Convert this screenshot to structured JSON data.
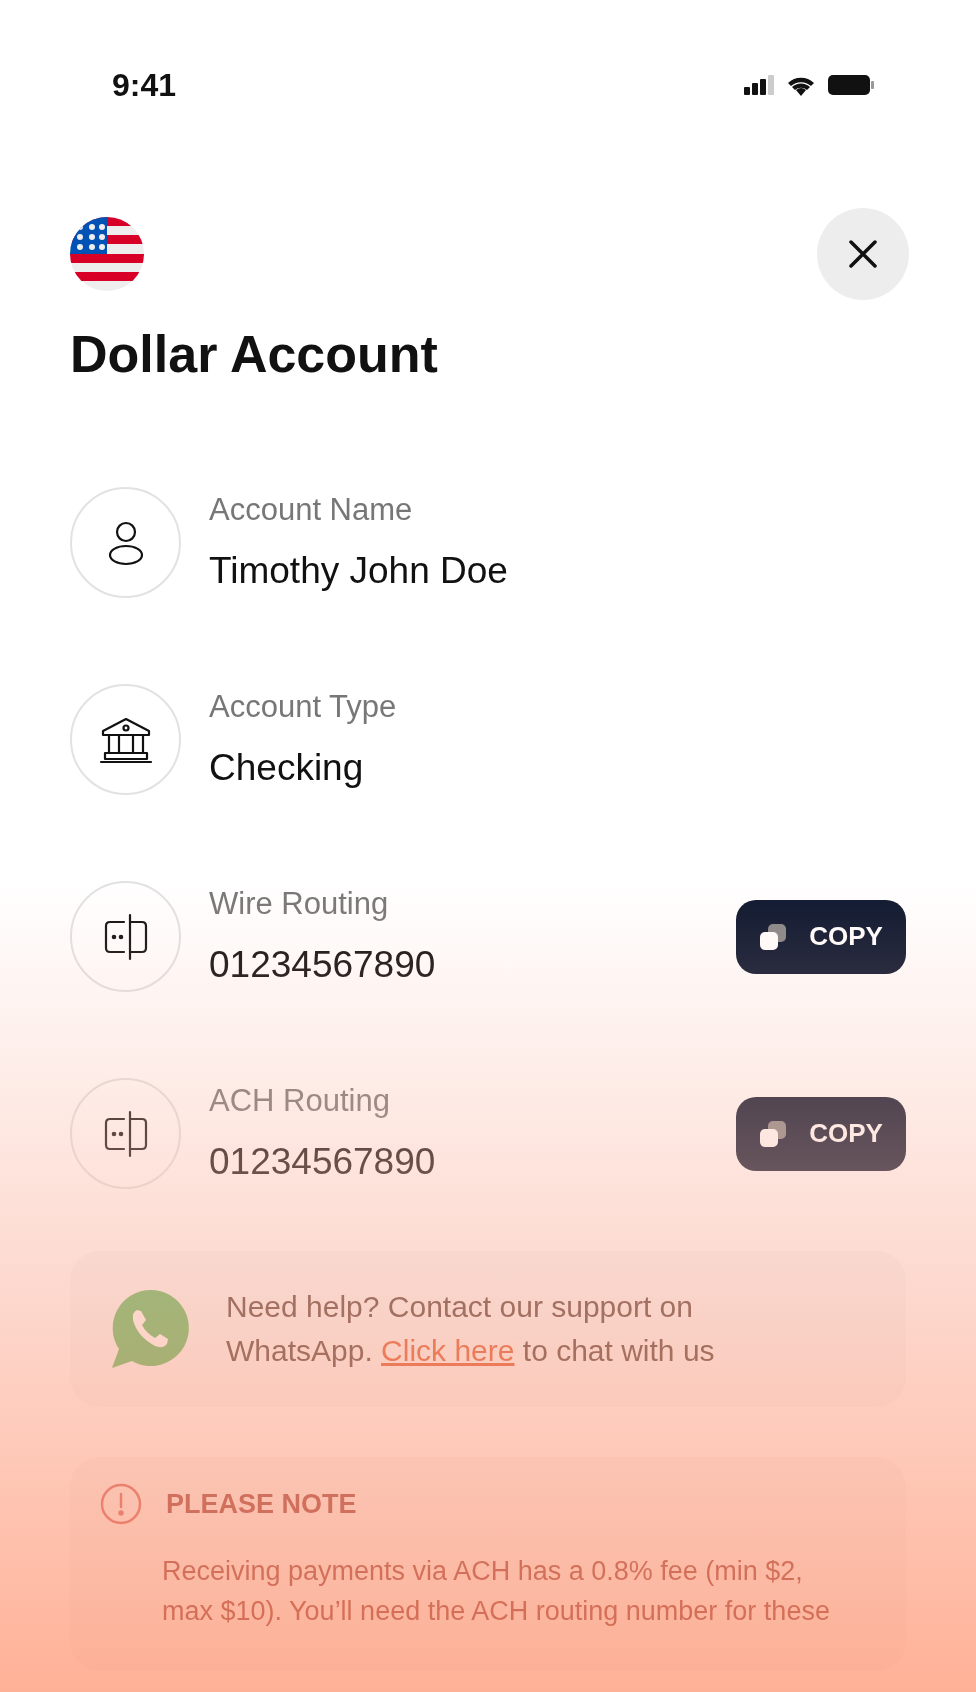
{
  "status_bar": {
    "time": "9:41"
  },
  "title": "Dollar Account",
  "fields": [
    {
      "kind": "person",
      "label": "Account Name",
      "value": "Timothy John Doe"
    },
    {
      "kind": "bank",
      "label": "Account Type",
      "value": "Checking"
    },
    {
      "kind": "routing",
      "label": "Wire Routing",
      "value": "01234567890",
      "copy_button": "COPY"
    },
    {
      "kind": "routing",
      "label": "ACH Routing",
      "value": "01234567890",
      "copy_button": "COPY"
    }
  ],
  "help": {
    "text_before": "Need help? Contact our support on WhatsApp.",
    "link": "Click here",
    "text_after": "to chat with us"
  },
  "note": {
    "title": "PLEASE NOTE",
    "text": "Receiving payments via ACH has a 0.8% fee (min $2, max $10). You’ll need the ACH routing number for these"
  }
}
